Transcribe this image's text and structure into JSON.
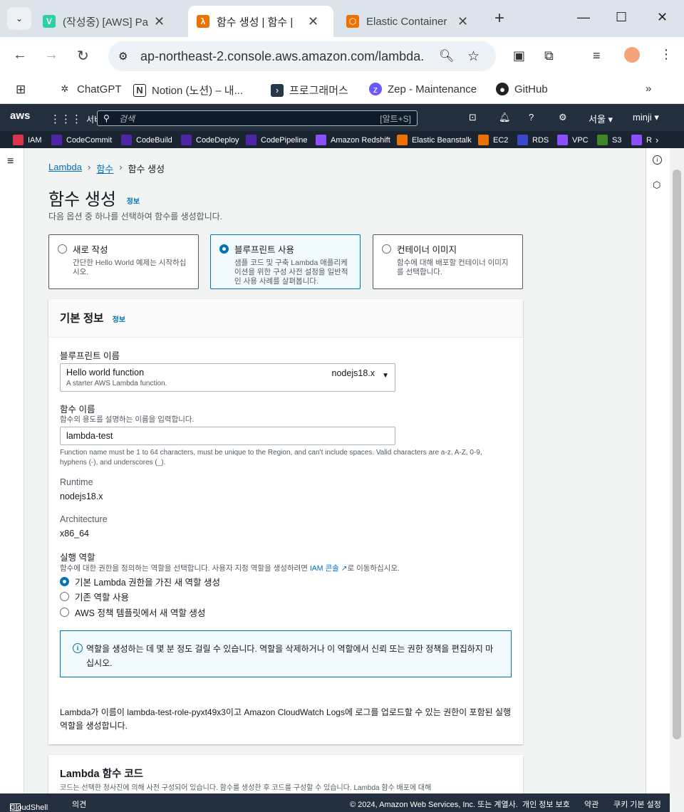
{
  "browser": {
    "tabs": [
      {
        "title": "(작성중) [AWS] Pa",
        "favicon": "V",
        "color": "#2bd1a3"
      },
      {
        "title": "함수 생성 | 함수 |",
        "favicon": "λ",
        "color": "#ed7100"
      },
      {
        "title": "Elastic Container",
        "favicon": "⬡",
        "color": "#ed7100"
      }
    ],
    "url": "ap-northeast-2.console.aws.amazon.com/lambda...",
    "bookmarks": [
      "ChatGPT",
      "Notion (노션) – 내...",
      "프로그래머스",
      "Zep - Maintenance",
      "GitHub"
    ]
  },
  "aws": {
    "logo": "aws",
    "services": "서비스",
    "search_placeholder": "검색",
    "shortcut": "[알트+S]",
    "region": "서울",
    "user": "minji",
    "favorites": [
      "IAM",
      "CodeCommit",
      "CodeBuild",
      "CodeDeploy",
      "CodePipeline",
      "Amazon Redshift",
      "Elastic Beanstalk",
      "EC2",
      "RDS",
      "VPC",
      "S3",
      "R"
    ]
  },
  "page": {
    "breadcrumb": [
      "Lambda",
      "함수",
      "함수 생성"
    ],
    "title": "함수 생성",
    "info": "정보",
    "subtitle": "다음 옵션 중 하나를 선택하여 함수를 생성합니다.",
    "options": [
      {
        "title": "새로 작성",
        "desc": "간단한 Hello World 예제는 시작하십시오."
      },
      {
        "title": "블루프린트 사용",
        "desc": "샘플 코드 및 구축 Lambda 애플리케이션을 위한 구성 사전 설정을 일반적인 사용 사례를 살펴봅니다."
      },
      {
        "title": "컨테이너 이미지",
        "desc": "함수에 대해 배포할 컨테이너 이미지를 선택합니다."
      }
    ],
    "basic": {
      "title": "기본 정보",
      "info": "정보",
      "blueprint_label": "블루프린트 이름",
      "blueprint_value": "Hello world function",
      "blueprint_runtime": "nodejs18.x",
      "blueprint_desc": "A starter AWS Lambda function.",
      "fn_label": "함수 이름",
      "fn_desc": "함수의 용도를 설명하는 이름을 입력합니다.",
      "fn_value": "lambda-test",
      "fn_hint": "Function name must be 1 to 64 characters, must be unique to the Region, and can't include spaces. Valid characters are a-z, A-Z, 0-9, hyphens (-), and underscores (_).",
      "runtime_label": "Runtime",
      "runtime_value": "nodejs18.x",
      "arch_label": "Architecture",
      "arch_value": "x86_64",
      "role_label": "실행 역할",
      "role_desc_pre": "함수에 대한 권한을 정의하는 역할을 선택합니다. 사용자 지정 역할을 생성하려면 ",
      "role_desc_link": "IAM 콘솔",
      "role_desc_post": "로 이동하십시오.",
      "role_options": [
        "기본 Lambda 권한을 가진 새 역할 생성",
        "기존 역할 사용",
        "AWS 정책 템플릿에서 새 역할 생성"
      ],
      "alert": "역할을 생성하는 데 몇 분 정도 걸릴 수 있습니다. 역할을 삭제하거나 이 역할에서 신뢰 또는 권한 정책을 편집하지 마십시오.",
      "note": "Lambda가 이름이 lambda-test-role-pyxt49x3이고 Amazon CloudWatch Logs에 로그를 업로드할 수 있는 권한이 포함된 실행 역할을 생성합니다."
    },
    "code": {
      "title": "Lambda 함수 코드",
      "desc": "코드는 선택한 청사진에 의해 사전 구성되어 있습니다. 함수를 생성한 후 코드를 구성할 수 있습니다. Lambda 함수 배포에 대해"
    }
  },
  "footer": {
    "cloudshell": "CloudShell",
    "feedback": "의견",
    "copyright": "© 2024, Amazon Web Services, Inc. 또는 계열사.",
    "privacy": "개인 정보 보호",
    "terms": "약관",
    "cookies": "쿠키 기본 설정"
  }
}
